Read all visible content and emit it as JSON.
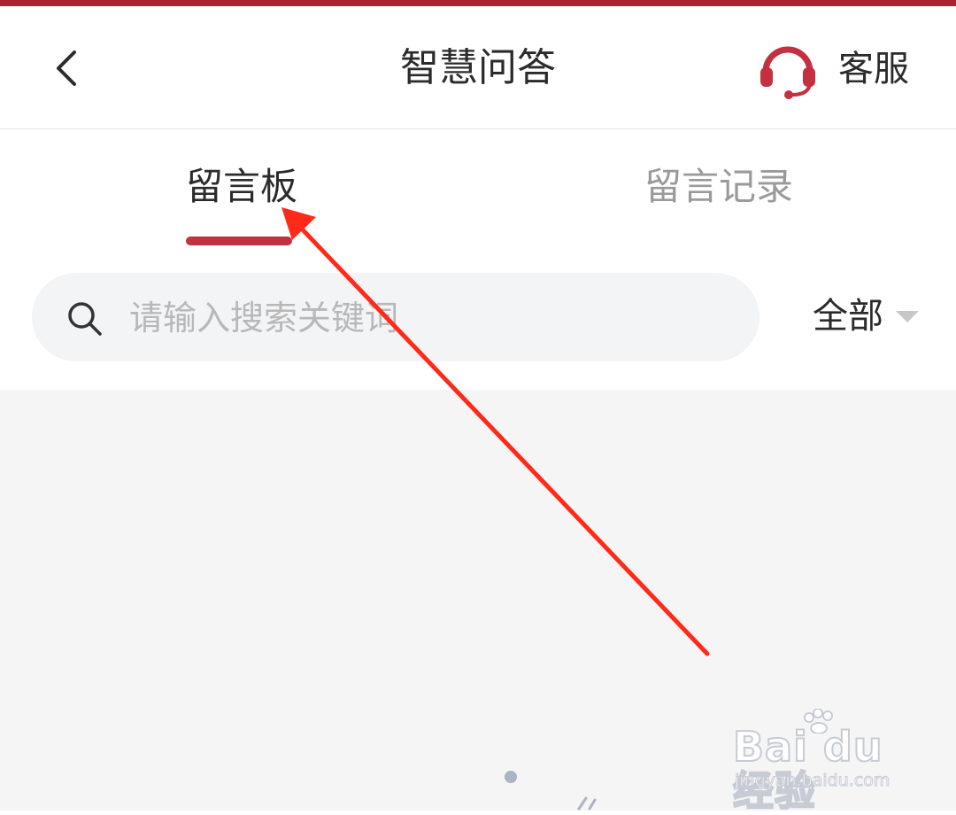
{
  "header": {
    "title": "智慧问答",
    "service_label": "客服",
    "back_icon": "chevron-left-icon",
    "service_icon": "headset-icon"
  },
  "tabs": [
    {
      "label": "留言板",
      "active": true
    },
    {
      "label": "留言记录",
      "active": false
    }
  ],
  "search": {
    "placeholder": "请输入搜索关键词",
    "value": "",
    "icon": "search-icon"
  },
  "filter": {
    "selected": "全部",
    "icon": "dropdown-triangle-icon"
  },
  "watermark": {
    "brand": "Bai du 经验",
    "url": "jingyan.baidu.com"
  },
  "colors": {
    "accent": "#c4303f",
    "top_strip": "#ad2232",
    "annotation_arrow": "#ff2a1a",
    "content_bg": "#f5f5f6"
  }
}
